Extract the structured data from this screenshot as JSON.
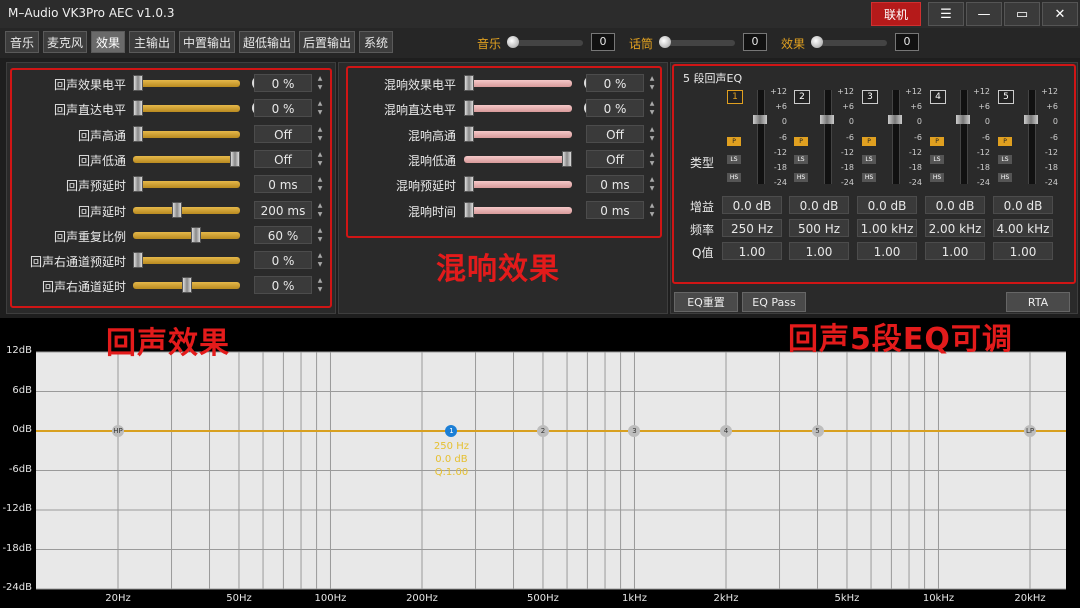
{
  "app": {
    "title": "M–Audio VK3Pro AEC  v1.0.3",
    "connect_label": "联机"
  },
  "tabs": [
    {
      "label": "音乐"
    },
    {
      "label": "麦克风"
    },
    {
      "label": "效果"
    },
    {
      "label": "主输出"
    },
    {
      "label": "中置输出"
    },
    {
      "label": "超低输出"
    },
    {
      "label": "后置输出"
    },
    {
      "label": "系统"
    }
  ],
  "active_tab": "效果",
  "mix": [
    {
      "label": "音乐",
      "value": "0",
      "level": 0
    },
    {
      "label": "话筒",
      "value": "0",
      "level": 0
    },
    {
      "label": "效果",
      "value": "0",
      "level": 0
    }
  ],
  "echo": {
    "annotation": "回声效果",
    "params": [
      {
        "label": "回声效果电平",
        "value": "0 %",
        "level": 0,
        "plus": true
      },
      {
        "label": "回声直达电平",
        "value": "0 %",
        "level": 0,
        "plus": true
      },
      {
        "label": "回声高通",
        "value": "Off",
        "level": 0,
        "plus": false
      },
      {
        "label": "回声低通",
        "value": "Off",
        "level": 1,
        "plus": false
      },
      {
        "label": "回声预延时",
        "value": "0 ms",
        "level": 0,
        "plus": false
      },
      {
        "label": "回声延时",
        "value": "200 ms",
        "level": 0.4,
        "plus": false
      },
      {
        "label": "回声重复比例",
        "value": "60 %",
        "level": 0.6,
        "plus": false
      },
      {
        "label": "回声右通道预延时",
        "value": "0 %",
        "level": 0,
        "plus": false
      },
      {
        "label": "回声右通道延时",
        "value": "0 %",
        "level": 0.5,
        "plus": false
      }
    ]
  },
  "reverb": {
    "annotation": "混响效果",
    "params": [
      {
        "label": "混响效果电平",
        "value": "0 %",
        "level": 0,
        "plus": true
      },
      {
        "label": "混响直达电平",
        "value": "0 %",
        "level": 0,
        "plus": true
      },
      {
        "label": "混响高通",
        "value": "Off",
        "level": 0,
        "plus": false
      },
      {
        "label": "混响低通",
        "value": "Off",
        "level": 1,
        "plus": false
      },
      {
        "label": "混响预延时",
        "value": "0 ms",
        "level": 0,
        "plus": false
      },
      {
        "label": "混响时间",
        "value": "0 ms",
        "level": 0,
        "plus": false
      }
    ]
  },
  "eq": {
    "title": "5 段回声EQ",
    "annotation": "回声5段EQ可调",
    "scale": [
      "+12",
      "+6",
      "0",
      "-6",
      "-12",
      "-18",
      "-24"
    ],
    "type_label": "类型",
    "gain_label": "增益",
    "freq_label": "频率",
    "q_label": "Q值",
    "type_buttons": [
      "P",
      "LS",
      "HS"
    ],
    "bands": [
      {
        "num": "1",
        "gain": "0.0 dB",
        "freq": "250 Hz",
        "q": "1.00",
        "type": "P",
        "selected": true
      },
      {
        "num": "2",
        "gain": "0.0 dB",
        "freq": "500 Hz",
        "q": "1.00",
        "type": "P",
        "selected": false
      },
      {
        "num": "3",
        "gain": "0.0 dB",
        "freq": "1.00 kHz",
        "q": "1.00",
        "type": "P",
        "selected": false
      },
      {
        "num": "4",
        "gain": "0.0 dB",
        "freq": "2.00 kHz",
        "q": "1.00",
        "type": "P",
        "selected": false
      },
      {
        "num": "5",
        "gain": "0.0 dB",
        "freq": "4.00 kHz",
        "q": "1.00",
        "type": "P",
        "selected": false
      }
    ],
    "reset_label": "EQ重置",
    "pass_label": "EQ Pass",
    "rta_label": "RTA"
  },
  "graph": {
    "y_labels": [
      "12dB",
      "6dB",
      "0dB",
      "-6dB",
      "-12dB",
      "-18dB",
      "-24dB"
    ],
    "x_labels": [
      "20Hz",
      "50Hz",
      "100Hz",
      "200Hz",
      "500Hz",
      "1kHz",
      "2kHz",
      "5kHz",
      "10kHz",
      "20kHz"
    ],
    "nodes": [
      {
        "label": "HP",
        "freq_hz": 20,
        "gain_db": 0
      },
      {
        "label": "1",
        "freq_hz": 250,
        "gain_db": 0
      },
      {
        "label": "2",
        "freq_hz": 500,
        "gain_db": 0
      },
      {
        "label": "3",
        "freq_hz": 1000,
        "gain_db": 0
      },
      {
        "label": "4",
        "freq_hz": 2000,
        "gain_db": 0
      },
      {
        "label": "5",
        "freq_hz": 4000,
        "gain_db": 0
      },
      {
        "label": "LP",
        "freq_hz": 20000,
        "gain_db": 0
      }
    ],
    "selected_info": {
      "freq": "250 Hz",
      "gain": "0.0 dB",
      "q": "Q:1.00"
    }
  },
  "colors": {
    "accent": "#e0a020",
    "annotation": "#e31b1b",
    "curve": "#d8a020",
    "selected_node": "#1c7fd6"
  }
}
